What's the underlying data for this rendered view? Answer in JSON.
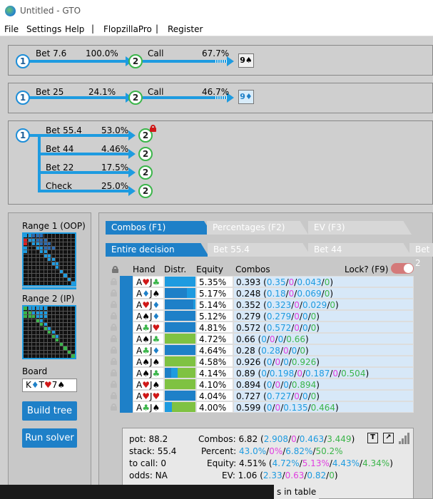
{
  "window": {
    "title": "Untitled - GTO"
  },
  "menu": {
    "file": "File",
    "settings": "Settings",
    "help": "Help",
    "sep": "|",
    "flopzilla": "FlopzillaPro",
    "register": "Register"
  },
  "tree": {
    "line1": {
      "root": "1",
      "action1": "Bet 7.6",
      "pct1": "100.0%",
      "node2": "2",
      "action2": "Call",
      "pct2": "67.7%",
      "card": "9♠"
    },
    "line2": {
      "root": "1",
      "action1": "Bet 25",
      "pct1": "24.1%",
      "node2": "2",
      "action2": "Call",
      "pct2": "46.7%",
      "card": "9♦"
    },
    "line3": {
      "root": "1",
      "branches": [
        {
          "label": "Bet 55.4",
          "pct": "53.0%",
          "node": "2"
        },
        {
          "label": "Bet 44",
          "pct": "4.46%",
          "node": "2"
        },
        {
          "label": "Bet 22",
          "pct": "17.5%",
          "node": "2"
        },
        {
          "label": "Check",
          "pct": "25.0%",
          "node": "2"
        }
      ]
    }
  },
  "left": {
    "range1_title": "Range 1 (OOP)",
    "range2_title": "Range 2 (IP)",
    "board_label": "Board",
    "board_cards": [
      {
        "rank": "K",
        "suit": "♦",
        "color": "#1e80c8"
      },
      {
        "rank": "T",
        "suit": "♥",
        "color": "#d01818"
      },
      {
        "rank": "7",
        "suit": "♠",
        "color": "#000000"
      }
    ],
    "build_tree": "Build tree",
    "run_solver": "Run solver"
  },
  "tabs": {
    "row1": [
      "Combos (F1)",
      "Percentages (F2)",
      "EV (F3)"
    ],
    "row2": [
      "Entire decision",
      "Bet 55.4",
      "Bet 44",
      "Bet 2"
    ]
  },
  "table": {
    "headers": {
      "hand": "Hand",
      "distr": "Distr.",
      "equity": "Equity",
      "combos": "Combos",
      "lock": "Lock? (F9)"
    },
    "rows": [
      {
        "r1": "A",
        "s1": "♥",
        "s1c": "#d01818",
        "r2": "J",
        "s2": "♣",
        "s2c": "#3bb54a",
        "equity": "5.35%",
        "total": "0.393",
        "p": [
          "0.35",
          "0",
          "0.043",
          "0"
        ],
        "distr": [
          0,
          0,
          1,
          0
        ]
      },
      {
        "r1": "A",
        "s1": "♦",
        "s1c": "#1e80c8",
        "r2": "J",
        "s2": "♠",
        "s2c": "#000000",
        "equity": "5.17%",
        "total": "0.248",
        "p": [
          "0.18",
          "0",
          "0.069",
          "0"
        ],
        "distr": [
          0.72,
          0,
          0.28,
          0
        ]
      },
      {
        "r1": "A",
        "s1": "♥",
        "s1c": "#d01818",
        "r2": "J",
        "s2": "♦",
        "s2c": "#1e80c8",
        "equity": "5.14%",
        "total": "0.352",
        "p": [
          "0.323",
          "0",
          "0.029",
          "0"
        ],
        "distr": [
          0.92,
          0,
          0.08,
          0
        ]
      },
      {
        "r1": "A",
        "s1": "♠",
        "s1c": "#000000",
        "r2": "J",
        "s2": "♦",
        "s2c": "#1e80c8",
        "equity": "5.12%",
        "total": "0.279",
        "p": [
          "0.279",
          "0",
          "0",
          "0"
        ],
        "distr": [
          1,
          0,
          0,
          0
        ]
      },
      {
        "r1": "A",
        "s1": "♣",
        "s1c": "#3bb54a",
        "r2": "J",
        "s2": "♥",
        "s2c": "#d01818",
        "equity": "4.81%",
        "total": "0.572",
        "p": [
          "0.572",
          "0",
          "0",
          "0"
        ],
        "distr": [
          1,
          0,
          0,
          0
        ]
      },
      {
        "r1": "A",
        "s1": "♠",
        "s1c": "#000000",
        "r2": "J",
        "s2": "♣",
        "s2c": "#3bb54a",
        "equity": "4.72%",
        "total": "0.66",
        "p": [
          "0",
          "0",
          "0",
          "0.66"
        ],
        "distr": [
          0,
          0,
          0,
          1
        ]
      },
      {
        "r1": "A",
        "s1": "♣",
        "s1c": "#3bb54a",
        "r2": "J",
        "s2": "♦",
        "s2c": "#1e80c8",
        "equity": "4.64%",
        "total": "0.28",
        "p": [
          "0.28",
          "0",
          "0",
          "0"
        ],
        "distr": [
          1,
          0,
          0,
          0
        ]
      },
      {
        "r1": "A",
        "s1": "♠",
        "s1c": "#000000",
        "r2": "J",
        "s2": "♠",
        "s2c": "#000000",
        "equity": "4.58%",
        "total": "0.926",
        "p": [
          "0",
          "0",
          "0",
          "0.926"
        ],
        "distr": [
          0,
          0,
          0,
          1
        ]
      },
      {
        "r1": "A",
        "s1": "♠",
        "s1c": "#000000",
        "r2": "J",
        "s2": "♣",
        "s2c": "#3bb54a",
        "equity": "4.14%",
        "total": "0.89",
        "p": [
          "0",
          "0.198",
          "0",
          "0.187",
          "0",
          "0.504"
        ],
        "distr": [
          0.22,
          0,
          0.21,
          0.57
        ]
      },
      {
        "r1": "A",
        "s1": "♥",
        "s1c": "#d01818",
        "r2": "J",
        "s2": "♠",
        "s2c": "#000000",
        "equity": "4.10%",
        "total": "0.894",
        "p": [
          "0",
          "0",
          "0",
          "0.894"
        ],
        "distr": [
          0,
          0,
          0,
          1
        ]
      },
      {
        "r1": "A",
        "s1": "♥",
        "s1c": "#d01818",
        "r2": "J",
        "s2": "♥",
        "s2c": "#d01818",
        "equity": "4.04%",
        "total": "0.727",
        "p": [
          "0.727",
          "0",
          "0",
          "0"
        ],
        "distr": [
          1,
          0,
          0,
          0
        ]
      },
      {
        "r1": "A",
        "s1": "♣",
        "s1c": "#3bb54a",
        "r2": "J",
        "s2": "♠",
        "s2c": "#000000",
        "equity": "4.00%",
        "total": "0.599",
        "p": [
          "0",
          "0",
          "0.135",
          "0.464"
        ],
        "distr": [
          0,
          0,
          0.23,
          0.77
        ]
      }
    ]
  },
  "stats": {
    "pot": "pot: 88.2",
    "stack": "stack: 55.4",
    "to_call": "to call: 0",
    "odds": "odds: NA",
    "combos_label": "Combos: ",
    "combos_total": "6.82",
    "combos_parts": [
      "2.908",
      "0",
      "0.463",
      "3.449"
    ],
    "percent_label": "Percent: ",
    "percent_parts": [
      "43.0%",
      "0%",
      "6.82%",
      "50.2%"
    ],
    "equity_label": "Equity: ",
    "equity_total": "4.51%",
    "equity_parts": [
      "4.72%",
      "5.13%",
      "4.43%",
      "4.34%"
    ],
    "ev_label": "EV: ",
    "ev_total": "1.06",
    "ev_parts": [
      "2.33",
      "0.63",
      "0.82",
      "0"
    ]
  },
  "hint": "s in table",
  "colors": {
    "accent": "#1e80c8",
    "check": "#1e80c8",
    "bet_small": "#1e9be0",
    "bet_mid": "#2ad4e8",
    "bet_big": "#7fc242"
  }
}
